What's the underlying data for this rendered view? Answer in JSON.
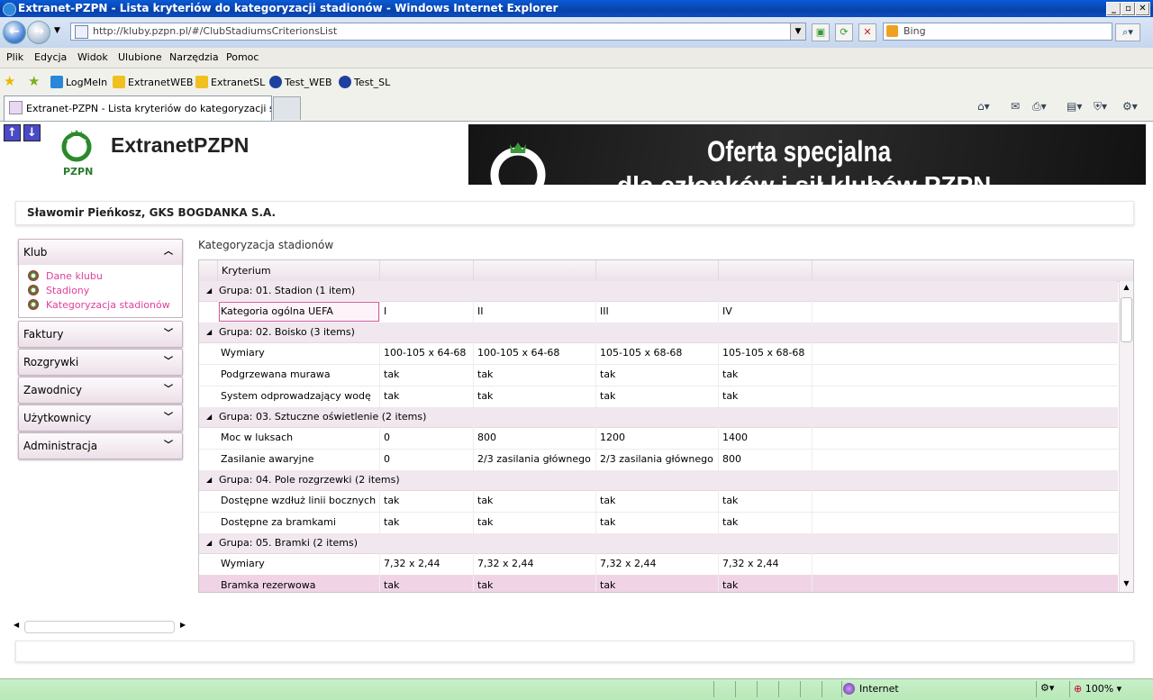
{
  "window": {
    "title": "Extranet-PZPN - Lista kryteriów do kategoryzacji stadionów - Windows Internet Explorer"
  },
  "address_bar": {
    "url": "http://kluby.pzpn.pl/#/ClubStadiumsCriterionsList",
    "search_placeholder": "Bing"
  },
  "menu": [
    "Plik",
    "Edycja",
    "Widok",
    "Ulubione",
    "Narzędzia",
    "Pomoc"
  ],
  "favorites": [
    "LogMeIn",
    "ExtranetWEB",
    "ExtranetSL",
    "Test_WEB",
    "Test_SL"
  ],
  "tabs": {
    "active": "Extranet-PZPN - Lista kryteriów do kategoryzacji stadi..."
  },
  "header": {
    "logo_text": "PZPN",
    "brand": "ExtranetPZPN",
    "banner_line1": "Oferta specjalna",
    "banner_line2": "dla członków i sił klubów PZPN",
    "user": "Sławomir Pieńkosz, GKS BOGDANKA S.A."
  },
  "sidebar": {
    "sections": [
      {
        "label": "Klub",
        "expanded": true,
        "items": [
          "Dane klubu",
          "Stadiony",
          "Kategoryzacja stadionów"
        ]
      },
      {
        "label": "Faktury"
      },
      {
        "label": "Rozgrywki"
      },
      {
        "label": "Zawodnicy"
      },
      {
        "label": "Użytkownicy"
      },
      {
        "label": "Administracja"
      }
    ]
  },
  "main": {
    "breadcrumb": "Kategoryzacja stadionów",
    "grid_header": "Kryterium",
    "groups": [
      {
        "label": "Grupa: 01. Stadion (1 item)",
        "rows": [
          [
            "Kategoria ogólna UEFA",
            "I",
            "II",
            "III",
            "IV"
          ]
        ]
      },
      {
        "label": "Grupa: 02. Boisko (3 items)",
        "rows": [
          [
            "Wymiary",
            "100-105 x 64-68",
            "100-105 x 64-68",
            "105-105 x 68-68",
            "105-105 x 68-68"
          ],
          [
            "Podgrzewana murawa",
            "tak",
            "tak",
            "tak",
            "tak"
          ],
          [
            "System odprowadzający wodę",
            "tak",
            "tak",
            "tak",
            "tak"
          ]
        ]
      },
      {
        "label": "Grupa: 03. Sztuczne oświetlenie (2 items)",
        "rows": [
          [
            "Moc w luksach",
            "0",
            "800",
            "1200",
            "1400"
          ],
          [
            "Zasilanie awaryjne",
            "0",
            "2/3 zasilania głównego",
            "2/3 zasilania głównego",
            "800"
          ]
        ]
      },
      {
        "label": "Grupa: 04. Pole rozgrzewki (2 items)",
        "rows": [
          [
            "Dostępne wzdłuż linii bocznych",
            "tak",
            "tak",
            "tak",
            "tak"
          ],
          [
            "Dostępne za bramkami",
            "tak",
            "tak",
            "tak",
            "tak"
          ]
        ]
      },
      {
        "label": "Grupa: 05. Bramki (2 items)",
        "rows": [
          [
            "Wymiary",
            "7,32 x 2,44",
            "7,32 x 2,44",
            "7,32 x 2,44",
            "7,32 x 2,44"
          ],
          [
            "Bramka rezerwowa",
            "tak",
            "tak",
            "tak",
            "tak"
          ]
        ]
      }
    ]
  },
  "status_bar": {
    "zone": "Internet",
    "zoom": "100%"
  },
  "colors": {
    "titlebar": "#0a4cc0",
    "accent_pink": "#e0409a",
    "group_row": "#f1e7ee",
    "selected_row": "#f0d4e6",
    "status_bar": "#c8f0c8"
  }
}
